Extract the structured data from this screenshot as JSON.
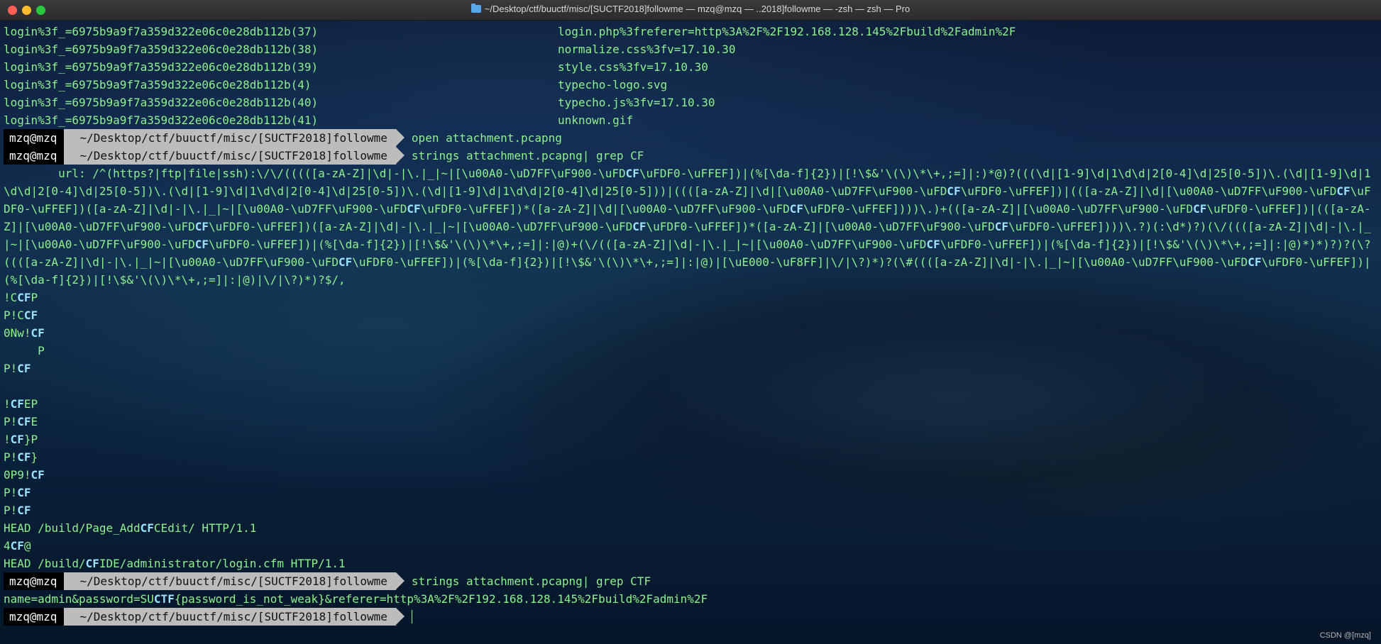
{
  "window": {
    "title": "~/Desktop/ctf/buuctf/misc/[SUCTF2018]followme — mzq@mzq — ..2018]followme — -zsh — zsh — Pro"
  },
  "listing": [
    {
      "left": "login%3f_=6975b9a9f7a359d322e06c0e28db112b(37)",
      "right": "login.php%3freferer=http%3A%2F%2F192.168.128.145%2Fbuild%2Fadmin%2F"
    },
    {
      "left": "login%3f_=6975b9a9f7a359d322e06c0e28db112b(38)",
      "right": "normalize.css%3fv=17.10.30"
    },
    {
      "left": "login%3f_=6975b9a9f7a359d322e06c0e28db112b(39)",
      "right": "style.css%3fv=17.10.30"
    },
    {
      "left": "login%3f_=6975b9a9f7a359d322e06c0e28db112b(4)",
      "right": "typecho-logo.svg"
    },
    {
      "left": "login%3f_=6975b9a9f7a359d322e06c0e28db112b(40)",
      "right": "typecho.js%3fv=17.10.30"
    },
    {
      "left": "login%3f_=6975b9a9f7a359d322e06c0e28db112b(41)",
      "right": "unknown.gif"
    }
  ],
  "prompt": {
    "user": "mzq@mzq",
    "path": "~/Desktop/ctf/buuctf/misc/[SUCTF2018]followme"
  },
  "commands": {
    "c1": "open attachment.pcapng",
    "c2": "strings attachment.pcapng| grep CF",
    "c3": "strings attachment.pcapng| grep CTF"
  },
  "output_cf": [
    "        url: /^(https?|ftp|file|ssh):\\/\\/(((([a-zA-Z]|\\d|-|\\.|_|~|[\\u00A0-\\uD7FF\\uF900-\\uFDCF\\uFDF0-\\uFFEF])|(%[\\da-f]{2})|[!\\$&'\\(\\)\\*\\+,;=]|:)*@)?(((\\d|[1-9]\\d|1\\d\\d|2[0-4]\\d|25[0-5])\\.(\\d|[1-9]\\d|1\\d\\d|2[0-4]\\d|25[0-5])\\.(\\d|[1-9]\\d|1\\d\\d|2[0-4]\\d|25[0-5])\\.(\\d|[1-9]\\d|1\\d\\d|2[0-4]\\d|25[0-5]))|((([a-zA-Z]|\\d|[\\u00A0-\\uD7FF\\uF900-\\uFDCF\\uFDF0-\\uFFEF])|(([a-zA-Z]|\\d|[\\u00A0-\\uD7FF\\uF900-\\uFDCF\\uFDF0-\\uFFEF])([a-zA-Z]|\\d|-|\\.|_|~|[\\u00A0-\\uD7FF\\uF900-\\uFDCF\\uFDF0-\\uFFEF])*([a-zA-Z]|\\d|[\\u00A0-\\uD7FF\\uF900-\\uFDCF\\uFDF0-\\uFFEF])))\\.)+(([a-zA-Z]|[\\u00A0-\\uD7FF\\uF900-\\uFDCF\\uFDF0-\\uFFEF])|(([a-zA-Z]|[\\u00A0-\\uD7FF\\uF900-\\uFDCF\\uFDF0-\\uFFEF])([a-zA-Z]|\\d|-|\\.|_|~|[\\u00A0-\\uD7FF\\uF900-\\uFDCF\\uFDF0-\\uFFEF])*([a-zA-Z]|[\\u00A0-\\uD7FF\\uF900-\\uFDCF\\uFDF0-\\uFFEF])))\\.?)(:\\d*)?)(\\/((([a-zA-Z]|\\d|-|\\.|_|~|[\\u00A0-\\uD7FF\\uF900-\\uFDCF\\uFDF0-\\uFFEF])|(%[\\da-f]{2})|[!\\$&'\\(\\)\\*\\+,;=]|:|@)+(\\/(([a-zA-Z]|\\d|-|\\.|_|~|[\\u00A0-\\uD7FF\\uF900-\\uFDCF\\uFDF0-\\uFFEF])|(%[\\da-f]{2})|[!\\$&'\\(\\)\\*\\+,;=]|:|@)*)*)?)?(\\?((([a-zA-Z]|\\d|-|\\.|_|~|[\\u00A0-\\uD7FF\\uF900-\\uFDCF\\uFDF0-\\uFFEF])|(%[\\da-f]{2})|[!\\$&'\\(\\)\\*\\+,;=]|:|@)|[\\uE000-\\uF8FF]|\\/|\\?)*)?(\\#((([a-zA-Z]|\\d|-|\\.|_|~|[\\u00A0-\\uD7FF\\uF900-\\uFDCF\\uFDF0-\\uFFEF])|(%[\\da-f]{2})|[!\\$&'\\(\\)\\*\\+,;=]|:|@)|\\/|\\?)*)?$/,",
    "!CCFP",
    "P!CCF",
    "0Nw!CF",
    "     P",
    "P!CF",
    "",
    "!CFEP",
    "P!CFE",
    "!CF}P",
    "P!CF}",
    "0P9!CF",
    "P!CF",
    "P!CF",
    "HEAD /build/Page_AddCFCEdit/ HTTP/1.1",
    "4CF@",
    "HEAD /build/CFIDE/administrator/login.cfm HTTP/1.1"
  ],
  "output_ctf": "name=admin&password=SUCTF{password_is_not_weak}&referer=http%3A%2F%2F192.168.128.145%2Fbuild%2Fadmin%2F",
  "watermark": "CSDN @[mzq]",
  "colors": {
    "output_text": "#8ef28e",
    "match_highlight": "#9de3ff",
    "prompt_user_bg": "#000000",
    "prompt_path_bg": "#bcbcbc"
  }
}
